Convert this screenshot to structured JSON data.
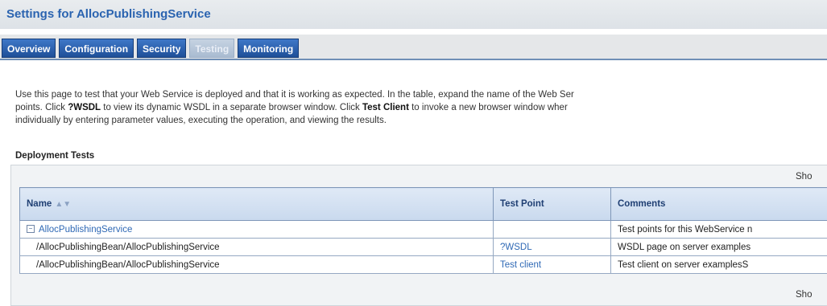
{
  "header": {
    "title": "Settings for AllocPublishingService"
  },
  "tabs": [
    {
      "label": "Overview",
      "active": false
    },
    {
      "label": "Configuration",
      "active": false
    },
    {
      "label": "Security",
      "active": false
    },
    {
      "label": "Testing",
      "active": true
    },
    {
      "label": "Monitoring",
      "active": false
    }
  ],
  "description": {
    "line1": "Use this page to test that your Web Service is deployed and that it is working as expected. In the table, expand the name of the Web Ser",
    "line2_a": "points. Click ",
    "line2_wsdl": "?WSDL",
    "line2_b": " to view its dynamic WSDL in a separate browser window. Click ",
    "line2_client": "Test Client",
    "line2_c": " to invoke a new browser window wher",
    "line3": "individually by entering parameter values, executing the operation, and viewing the results."
  },
  "deployment_tests": {
    "section_title": "Deployment Tests",
    "showing_top": "Sho",
    "showing_bottom": "Sho",
    "columns": {
      "name": "Name",
      "test_point": "Test Point",
      "comments": "Comments"
    },
    "rows": [
      {
        "toggle": "−",
        "name": "AllocPublishingService",
        "test_point": "",
        "comments": "Test points for this WebService n"
      },
      {
        "name": "/AllocPublishingBean/AllocPublishingService",
        "test_point": "?WSDL",
        "comments": "WSDL page on server examples"
      },
      {
        "name": "/AllocPublishingBean/AllocPublishingService",
        "test_point": "Test client",
        "comments": "Test client on server examplesS"
      }
    ]
  },
  "icons": {
    "sort": "sort-arrows-icon",
    "tree": "tree-collapse-icon"
  },
  "colors": {
    "accent": "#2a63b0",
    "tab_blue": "#1e4f98",
    "link": "#2f69b5"
  }
}
